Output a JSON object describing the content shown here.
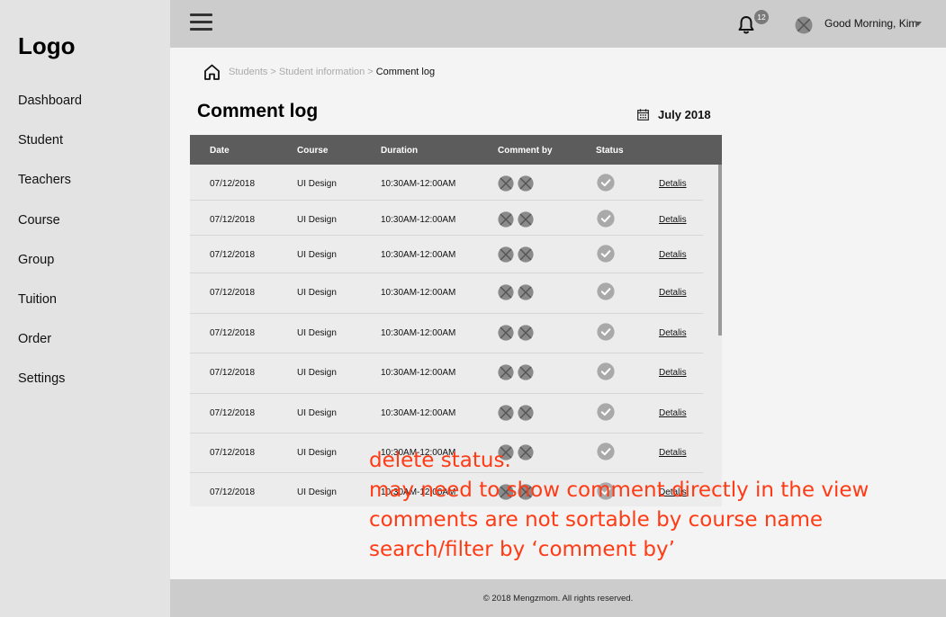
{
  "sidebar": {
    "logo": "Logo",
    "items": [
      {
        "label": "Dashboard"
      },
      {
        "label": "Student"
      },
      {
        "label": "Teachers"
      },
      {
        "label": "Course"
      },
      {
        "label": "Group"
      },
      {
        "label": "Tuition"
      },
      {
        "label": "Order"
      },
      {
        "label": "Settings"
      }
    ]
  },
  "header": {
    "menu_icon": "hamburger-icon",
    "notification_icon": "bell-icon",
    "notification_count": "12",
    "avatar_icon": "avatar-placeholder-icon",
    "greeting": "Good Morning, Kim",
    "dropdown_icon": "caret-down-icon"
  },
  "breadcrumb": {
    "home_icon": "home-icon",
    "items": [
      "Students",
      "Student information"
    ],
    "separator": ">",
    "current": "Comment log"
  },
  "page": {
    "title": "Comment log",
    "date_icon": "calendar-icon",
    "date_label": "July 2018"
  },
  "table": {
    "headers": [
      "Date",
      "Course",
      "Duration",
      "Comment by",
      "Status"
    ],
    "rows": [
      {
        "date": "07/12/2018",
        "course": "UI Design",
        "duration": "10:30AM-12:00AM",
        "details": "Detalis"
      },
      {
        "date": "07/12/2018",
        "course": "UI Design",
        "duration": "10:30AM-12:00AM",
        "details": "Detalis"
      },
      {
        "date": "07/12/2018",
        "course": "UI Design",
        "duration": "10:30AM-12:00AM",
        "details": "Detalis"
      },
      {
        "date": "07/12/2018",
        "course": "UI Design",
        "duration": "10:30AM-12:00AM",
        "details": "Detalis"
      },
      {
        "date": "07/12/2018",
        "course": "UI Design",
        "duration": "10:30AM-12:00AM",
        "details": "Detalis"
      },
      {
        "date": "07/12/2018",
        "course": "UI Design",
        "duration": "10:30AM-12:00AM",
        "details": "Detalis"
      },
      {
        "date": "07/12/2018",
        "course": "UI Design",
        "duration": "10:30AM-12:00AM",
        "details": "Detalis"
      },
      {
        "date": "07/12/2018",
        "course": "UI Design",
        "duration": "10:30AM-12:00AM",
        "details": "Detalis"
      },
      {
        "date": "07/12/2018",
        "course": "UI Design",
        "duration": "10:30AM-12:00AM",
        "details": "Detalis"
      }
    ]
  },
  "annotation": {
    "lines": [
      "delete status.",
      "may need to show comment directly in the view",
      "comments are not sortable by course name",
      "search/filter by ‘comment by’"
    ],
    "color": "#ff3b16"
  },
  "footer": {
    "copyright": "© 2018 Mengzmom. All rights reserved."
  },
  "colors": {
    "sidebar_bg": "#e3e3e3",
    "topbar_bg": "#cccccc",
    "table_header_bg": "#5c5c5c",
    "table_body_bg": "#ececec"
  }
}
